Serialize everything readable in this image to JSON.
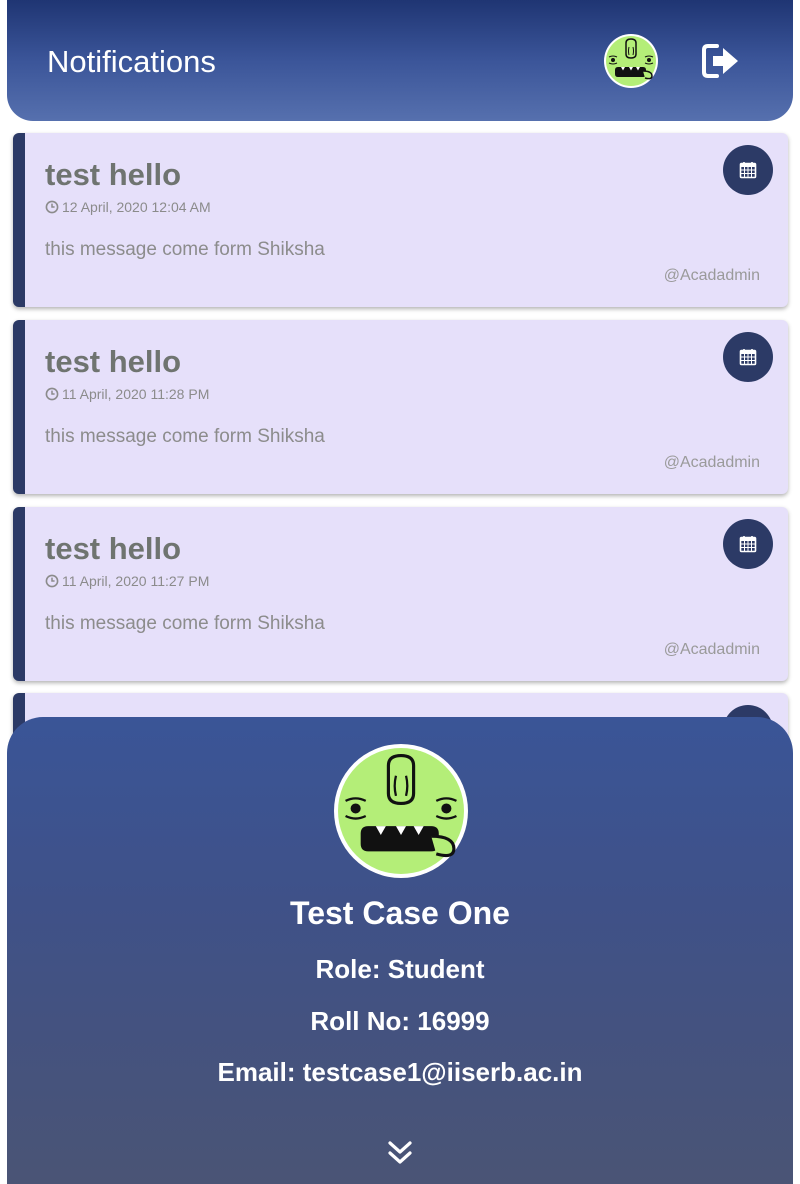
{
  "header": {
    "title": "Notifications",
    "avatar_icon": "monster-avatar-icon",
    "logout_icon": "sign-out-icon"
  },
  "notifications": [
    {
      "title": "test hello",
      "time": "12 April, 2020 12:04 AM",
      "message": "this message come form Shiksha",
      "author": "@Acadadmin"
    },
    {
      "title": "test hello",
      "time": "11 April, 2020 11:28 PM",
      "message": "this message come form Shiksha",
      "author": "@Acadadmin"
    },
    {
      "title": "test hello",
      "time": "11 April, 2020 11:27 PM",
      "message": "this message come form Shiksha",
      "author": "@Acadadmin"
    },
    {
      "title": "",
      "time": "",
      "message": "",
      "author": ""
    }
  ],
  "profile": {
    "name": "Test Case One",
    "role": "Role: Student",
    "roll": "Roll No: 16999",
    "email": "Email: testcase1@iiserb.ac.in",
    "expand_icon": "double-chevron-down-icon"
  },
  "colors": {
    "header_top": "#1f3573",
    "header_bottom": "#5670ae",
    "card_bg": "#e6e0fa",
    "card_accent": "#2c3a66",
    "avatar_green": "#b4ee78",
    "profile_top": "#3a5597",
    "profile_bottom": "#4a5475"
  }
}
